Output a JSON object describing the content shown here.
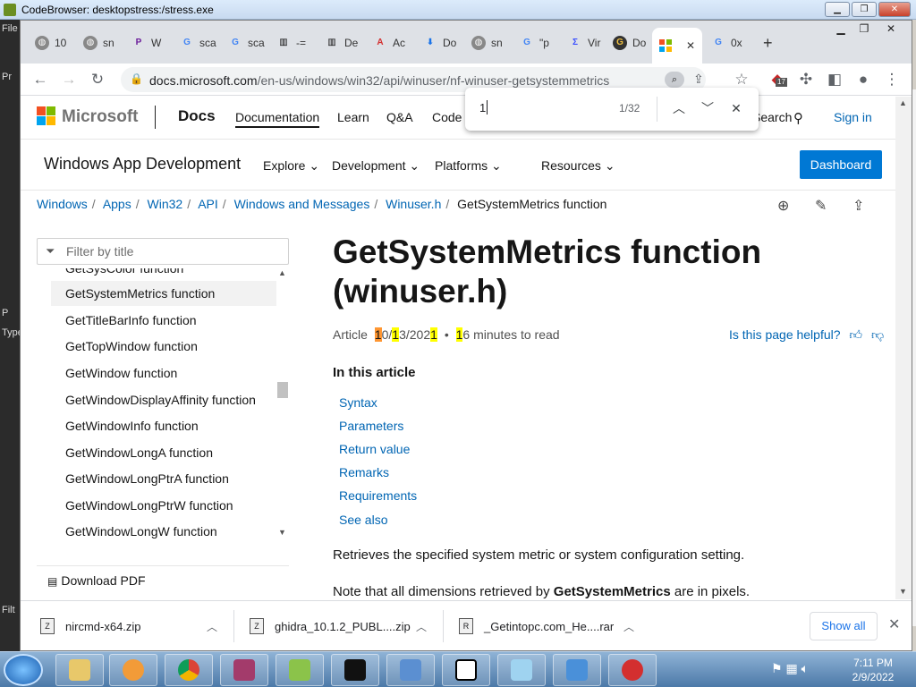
{
  "background_app": {
    "title": "CodeBrowser: desktopstress:/stress.exe",
    "left_labels": [
      "File",
      "Pr",
      "P",
      "Type",
      "Filt"
    ]
  },
  "browser": {
    "tabs": [
      {
        "label": "10",
        "icon": "globe-icon"
      },
      {
        "label": "sn",
        "icon": "globe-icon"
      },
      {
        "label": "W",
        "icon": "p-icon"
      },
      {
        "label": "sca",
        "icon": "google-icon"
      },
      {
        "label": "sca",
        "icon": "google-icon"
      },
      {
        "label": "-=",
        "icon": "library-icon"
      },
      {
        "label": "De",
        "icon": "library-icon"
      },
      {
        "label": "Ac",
        "icon": "acrobat-icon"
      },
      {
        "label": "Do",
        "icon": "download-icon"
      },
      {
        "label": "sn",
        "icon": "globe-icon"
      },
      {
        "label": "\"p",
        "icon": "google-icon"
      },
      {
        "label": "Vir",
        "icon": "virustotal-icon"
      },
      {
        "label": "Do",
        "icon": "g-icon"
      },
      {
        "label": "",
        "icon": "microsoft-icon"
      },
      {
        "label": "0x",
        "icon": "google-icon"
      }
    ],
    "url_domain": "docs.microsoft.com",
    "url_path": "/en-us/windows/win32/api/winuser/nf-winuser-getsystemmetrics",
    "extension_badge": "17"
  },
  "find_bar": {
    "value": "1",
    "count": "1/32"
  },
  "header": {
    "brand": "Microsoft",
    "docs": "Docs",
    "nav": [
      "Documentation",
      "Learn",
      "Q&A",
      "Code"
    ],
    "search": "Search",
    "sign_in": "Sign in"
  },
  "sub_header": {
    "title": "Windows App Development",
    "menus": [
      "Explore",
      "Development",
      "Platforms",
      "Resources"
    ],
    "dashboard": "Dashboard"
  },
  "breadcrumb": [
    "Windows",
    "Apps",
    "Win32",
    "API",
    "Windows and Messages",
    "Winuser.h",
    "GetSystemMetrics function"
  ],
  "toc": {
    "filter_placeholder": "Filter by title",
    "items": [
      "GetSysColor function",
      "GetSystemMetrics function",
      "GetTitleBarInfo function",
      "GetTopWindow function",
      "GetWindow function",
      "GetWindowDisplayAffinity function",
      "GetWindowInfo function",
      "GetWindowLongA function",
      "GetWindowLongPtrA function",
      "GetWindowLongPtrW function",
      "GetWindowLongW function"
    ],
    "selected_index": 1,
    "download_pdf": "Download PDF"
  },
  "article": {
    "title_line1": "GetSystemMetrics function",
    "title_line2": "(winuser.h)",
    "meta_article": "Article",
    "meta_date_parts": [
      "1",
      "0/",
      "1",
      "3/202",
      "1"
    ],
    "meta_read_hl": "1",
    "meta_read": "6 minutes to read",
    "helpful": "Is this page helpful?",
    "in_this_article": "In this article",
    "sections": [
      "Syntax",
      "Parameters",
      "Return value",
      "Remarks",
      "Requirements",
      "See also"
    ],
    "p1": "Retrieves the specified system metric or system configuration setting.",
    "p2_prefix": "Note that all dimensions retrieved by ",
    "p2_bold": "GetSystemMetrics",
    "p2_suffix": " are in pixels."
  },
  "downloads": [
    {
      "name": "nircmd-x64.zip"
    },
    {
      "name": "ghidra_10.1.2_PUBL....zip"
    },
    {
      "name": "_Getintopc.com_He....rar"
    }
  ],
  "downloads_show_all": "Show all",
  "taskbar": {
    "time": "7:11 PM",
    "date": "2/9/2022",
    "apps": [
      "explorer",
      "media-player",
      "chrome",
      "winrar",
      "notepad-plus",
      "cmd",
      "network",
      "7zip",
      "notepad",
      "control-panel",
      "ida"
    ]
  }
}
